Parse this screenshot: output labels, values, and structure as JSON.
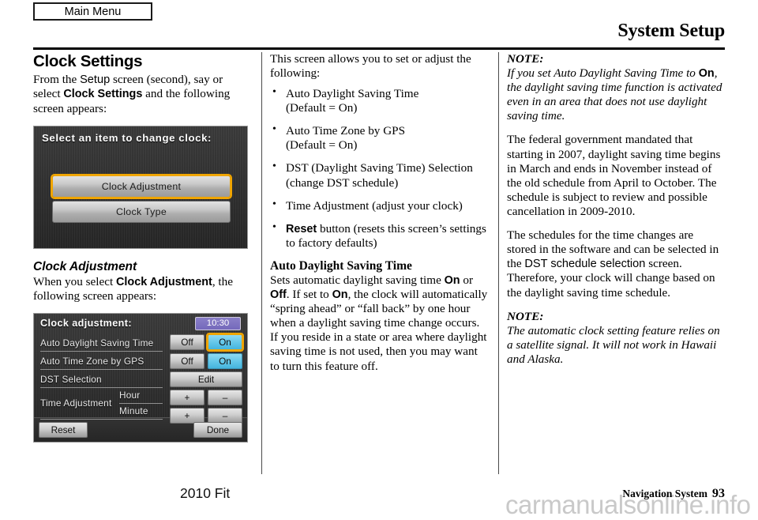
{
  "header": {
    "tab_label": "Main Menu",
    "title": "System Setup"
  },
  "col1": {
    "heading": "Clock Settings",
    "intro_a": "From the ",
    "intro_setup": "Setup",
    "intro_b": " screen (second), say or select ",
    "intro_clock_settings": "Clock Settings",
    "intro_c": " and the following screen appears:",
    "screen1": {
      "title": "Select an item to change clock:",
      "button_1": "Clock Adjustment",
      "button_2": "Clock Type"
    },
    "subheading": "Clock Adjustment",
    "sub_intro_a": "When you select ",
    "sub_intro_bold": "Clock Adjustment",
    "sub_intro_b": ", the following screen appears:",
    "screen2": {
      "title": "Clock adjustment:",
      "clock_value": "10:30",
      "row_1_label": "Auto Daylight Saving Time",
      "row_1_off": "Off",
      "row_1_on": "On",
      "row_2_label": "Auto Time Zone by GPS",
      "row_2_off": "Off",
      "row_2_on": "On",
      "row_3_label": "DST Selection",
      "row_3_edit": "Edit",
      "row_4_label": "Time Adjustment",
      "row_4_hour": "Hour",
      "row_4_minute": "Minute",
      "plus": "+",
      "minus": "–",
      "reset": "Reset",
      "done": "Done"
    }
  },
  "col2": {
    "intro": "This screen allows you to set or adjust the following:",
    "bullets": [
      "Auto Daylight Saving Time\n(Default = On)",
      "Auto Time Zone by GPS\n(Default = On)",
      "DST (Daylight Saving Time) Selection\n(change DST schedule)",
      "Time Adjustment (adjust your clock)"
    ],
    "bullet_reset_bold": "Reset",
    "bullet_reset_rest": " button (resets this screen’s settings to factory defaults)",
    "heading": "Auto Daylight Saving Time",
    "body_a": "Sets automatic daylight saving time ",
    "body_on1": "On",
    "body_b": " or ",
    "body_off": "Off",
    "body_c": ". If set to ",
    "body_on2": "On",
    "body_d": ", the clock will automatically “spring ahead” or “fall back” by one hour when a daylight saving time change occurs. If you reside in a state or area where daylight saving time is not used, then you may want to turn this feature off."
  },
  "col3": {
    "note_1_label": "NOTE:",
    "note_1_a": "If you set Auto Daylight Saving Time to ",
    "note_1_on": "On",
    "note_1_b": ", the daylight saving time function is activated even in an area that does not use daylight saving time.",
    "para_1": "The federal government mandated that starting in 2007, daylight saving time begins in March and ends in November instead of the old schedule from April to October. The schedule is subject to review and possible cancellation in 2009-2010.",
    "para_2_a": "The schedules for the time changes are stored in the software and can be selected in the ",
    "para_2_dst": "DST schedule selection",
    "para_2_b": " screen. Therefore, your clock will change based on the daylight saving time schedule.",
    "note_2_label": "NOTE:",
    "note_2_text": "The automatic clock setting feature relies on a satellite signal. It will not work in Hawaii and Alaska."
  },
  "footer": {
    "model": "2010 Fit",
    "section": "Navigation System",
    "page": "93",
    "watermark": "carmanualsonline.info"
  }
}
